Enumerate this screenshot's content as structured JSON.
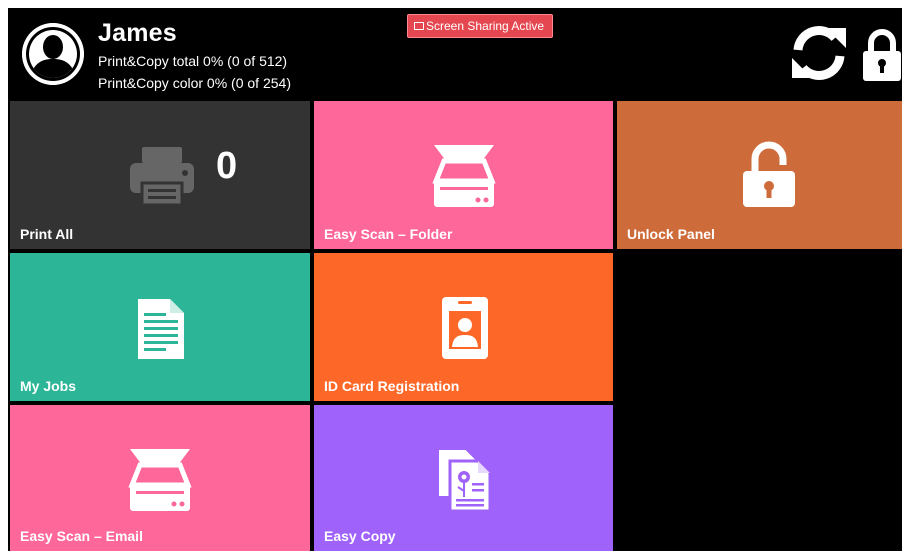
{
  "header": {
    "user_name": "James",
    "quota_total": "Print&Copy total 0% (0 of 512)",
    "quota_color": "Print&Copy color 0% (0 of 254)",
    "screen_sharing": "Screen Sharing Active"
  },
  "tiles": [
    {
      "label": "Print All",
      "count": "0",
      "color": "#333333",
      "icon": "printer-icon"
    },
    {
      "label": "Easy Scan – Folder",
      "color": "#fd6799",
      "icon": "scanner-icon"
    },
    {
      "label": "Unlock Panel",
      "color": "#cd6c3a",
      "icon": "unlocked-padlock-icon"
    },
    {
      "label": "My Jobs",
      "color": "#2db597",
      "icon": "document-icon"
    },
    {
      "label": "ID Card Registration",
      "color": "#fd6828",
      "icon": "id-card-icon"
    },
    {
      "label": "Easy Scan – Email",
      "color": "#fd6799",
      "icon": "scanner-icon"
    },
    {
      "label": "Easy Copy",
      "color": "#9f62fa",
      "icon": "copy-documents-icon"
    }
  ]
}
